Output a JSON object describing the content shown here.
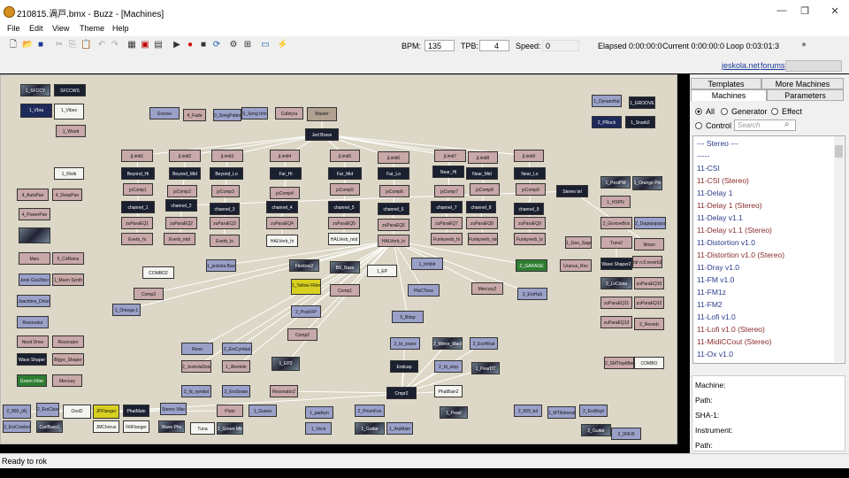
{
  "window": {
    "title": "210815.渦戸.bmx - Buzz - [Machines]",
    "minimize": "—",
    "restore": "❐",
    "close": "✕"
  },
  "menu": [
    "File",
    "Edit",
    "View",
    "Theme",
    "Help"
  ],
  "toolbar": {
    "bpm_label": "BPM:",
    "bpm_value": "135",
    "tpb_label": "TPB:",
    "tpb_value": "4",
    "speed_label": "Speed:",
    "speed_value": "0",
    "elapsed": "Elapsed 0:00:00:0",
    "current": "Current 0:00:00:0",
    "loop": "Loop 0:03:01:3"
  },
  "links": {
    "site": "jeskola.net",
    "forums": "forums"
  },
  "tabs": {
    "templates": "Templates",
    "more_machines": "More Machines",
    "machines": "Machines",
    "parameters": "Parameters"
  },
  "filters": {
    "all": "All",
    "generator": "Generator",
    "effect": "Effect",
    "control": "Control",
    "search_placeholder": "Search"
  },
  "machine_list": [
    {
      "name": "--- Stereo ---",
      "red": false
    },
    {
      "name": "-----",
      "red": false
    },
    {
      "name": "11-CSI",
      "red": false
    },
    {
      "name": "11-CSI (Stereo)",
      "red": true
    },
    {
      "name": "11-Delay 1",
      "red": false
    },
    {
      "name": "11-Delay 1 (Stereo)",
      "red": true
    },
    {
      "name": "11-Delay v1.1",
      "red": false
    },
    {
      "name": "11-Delay v1.1 (Stereo)",
      "red": true
    },
    {
      "name": "11-Distortion v1.0",
      "red": false
    },
    {
      "name": "11-Distortion v1.0 (Stereo)",
      "red": true
    },
    {
      "name": "11-Dray v1.0",
      "red": false
    },
    {
      "name": "11-FM v1.0",
      "red": false
    },
    {
      "name": "11-FM1z",
      "red": false
    },
    {
      "name": "11-FM2",
      "red": false
    },
    {
      "name": "11-Lofi v1.0",
      "red": false
    },
    {
      "name": "11-Lofi v1.0 (Stereo)",
      "red": true
    },
    {
      "name": "11-MidiCCout (Stereo)",
      "red": true
    },
    {
      "name": "11-Ox v1.0",
      "red": false
    }
  ],
  "info": {
    "machine": "Machine:",
    "path": "Path:",
    "sha": "SHA-1:",
    "instrument": "Instrument:",
    "path2": "Path:"
  },
  "status": "Ready to rok",
  "machines": [
    {
      "label": "1_SFCCY",
      "s": "img"
    },
    {
      "label": "SFCCWS",
      "s": "dark"
    },
    {
      "label": "1_Vbra",
      "s": "navy"
    },
    {
      "label": "1_Vibes",
      "s": "white"
    },
    {
      "label": "1_Wood",
      "s": "pink"
    },
    {
      "label": "1_Rivib",
      "s": "white"
    },
    {
      "label": "4_AutoPan",
      "s": "pink"
    },
    {
      "label": "4_DeepPan",
      "s": "pink"
    },
    {
      "label": "4_PowerPan",
      "s": "pink"
    },
    {
      "label": "",
      "s": "img"
    },
    {
      "label": "Marc",
      "s": "pink"
    },
    {
      "label": "5_CdReinz",
      "s": "pink"
    },
    {
      "label": "Jeek Gus2btcr",
      "s": "gen"
    },
    {
      "label": "1_Muon Synth",
      "s": "pink"
    },
    {
      "label": "Joachims_Drive",
      "s": "gen"
    },
    {
      "label": "Resonatur",
      "s": "gen"
    },
    {
      "label": "Nesit Drive",
      "s": "pink"
    },
    {
      "label": "Resonator",
      "s": "pink"
    },
    {
      "label": "Wave Shaper",
      "s": "dark"
    },
    {
      "label": "Bigyo_Shaper",
      "s": "pink"
    },
    {
      "label": "Green Filter",
      "s": "green"
    },
    {
      "label": "Mercury",
      "s": "pink"
    },
    {
      "label": "Groove",
      "s": "gen"
    },
    {
      "label": "4_Fade",
      "s": "pink"
    },
    {
      "label": "0_SongPattern",
      "s": "gen"
    },
    {
      "label": "0_Song Info",
      "s": "gen"
    },
    {
      "label": "Cafelyra",
      "s": "pink"
    },
    {
      "label": "Master",
      "s": "master"
    },
    {
      "label": "Jed Brave",
      "s": "dark"
    },
    {
      "label": "jLimit1",
      "s": "pink"
    },
    {
      "label": "jLimit2",
      "s": "pink"
    },
    {
      "label": "jLimit3",
      "s": "pink"
    },
    {
      "label": "jLimit4",
      "s": "pink"
    },
    {
      "label": "jLimit5",
      "s": "pink"
    },
    {
      "label": "jLimit6",
      "s": "pink"
    },
    {
      "label": "jLimit7",
      "s": "pink"
    },
    {
      "label": "jLimit8",
      "s": "pink"
    },
    {
      "label": "jLimit9",
      "s": "pink"
    },
    {
      "label": "Beyond_Hi",
      "s": "dark"
    },
    {
      "label": "Beyond_Mid",
      "s": "dark"
    },
    {
      "label": "Beyond_Lo",
      "s": "dark"
    },
    {
      "label": "Far_Hi",
      "s": "dark"
    },
    {
      "label": "Far_Mid",
      "s": "dark"
    },
    {
      "label": "Far_Lo",
      "s": "dark"
    },
    {
      "label": "Near_Hi",
      "s": "dark"
    },
    {
      "label": "Near_Mid",
      "s": "dark"
    },
    {
      "label": "Near_Lo",
      "s": "dark"
    },
    {
      "label": "jsComp1",
      "s": "pink"
    },
    {
      "label": "jsComp2",
      "s": "pink"
    },
    {
      "label": "jsComp3",
      "s": "pink"
    },
    {
      "label": "jsComp4",
      "s": "pink"
    },
    {
      "label": "jsComp5",
      "s": "pink"
    },
    {
      "label": "jsComp6",
      "s": "pink"
    },
    {
      "label": "jsComp7",
      "s": "pink"
    },
    {
      "label": "jsComp8",
      "s": "pink"
    },
    {
      "label": "jsComp9",
      "s": "pink"
    },
    {
      "label": "channel_1",
      "s": "dark"
    },
    {
      "label": "channel_2",
      "s": "dark"
    },
    {
      "label": "channel_3",
      "s": "dark"
    },
    {
      "label": "channel_4",
      "s": "dark"
    },
    {
      "label": "channel_5",
      "s": "dark"
    },
    {
      "label": "channel_6",
      "s": "dark"
    },
    {
      "label": "channel_7",
      "s": "dark"
    },
    {
      "label": "channel_8",
      "s": "dark"
    },
    {
      "label": "channel_9",
      "s": "dark"
    },
    {
      "label": "zuParaEQ1",
      "s": "pink"
    },
    {
      "label": "zuParaEQ2",
      "s": "pink"
    },
    {
      "label": "zuParaEQ3",
      "s": "pink"
    },
    {
      "label": "zuParaEQ4",
      "s": "pink"
    },
    {
      "label": "zuParaEQ5",
      "s": "pink"
    },
    {
      "label": "zuParaEQ6",
      "s": "pink"
    },
    {
      "label": "zuParaEQ7",
      "s": "pink"
    },
    {
      "label": "zuParaEQ8",
      "s": "pink"
    },
    {
      "label": "zuParaEQ9",
      "s": "pink"
    },
    {
      "label": "Everb_hi",
      "s": "pink"
    },
    {
      "label": "Everb_mid",
      "s": "pink"
    },
    {
      "label": "Everb_lo",
      "s": "pink"
    },
    {
      "label": "HALVerb_hi",
      "s": "white"
    },
    {
      "label": "HALVerb_mid",
      "s": "white"
    },
    {
      "label": "HALVerb_lo",
      "s": "pink"
    },
    {
      "label": "Funkyverb_hi",
      "s": "pink"
    },
    {
      "label": "Funkyverb_mid",
      "s": "pink"
    },
    {
      "label": "Funkyverb_lo",
      "s": "pink"
    },
    {
      "label": "Stereo tel",
      "s": "dark"
    },
    {
      "label": "1_DynamHat",
      "s": "gen"
    },
    {
      "label": "1_GROOVE",
      "s": "dark"
    },
    {
      "label": "2_PRock",
      "s": "navy"
    },
    {
      "label": "1_Snarb2",
      "s": "dark"
    },
    {
      "label": "1_PestPM",
      "s": "img"
    },
    {
      "label": "1_Orange Pin",
      "s": "img"
    },
    {
      "label": "1_HXPN",
      "s": "pink"
    },
    {
      "label": "2_GrooveBox",
      "s": "pink"
    },
    {
      "label": "2_Dagopapaya",
      "s": "gen"
    },
    {
      "label": "1_Geo_Sage",
      "s": "pink"
    },
    {
      "label": "Tuns2",
      "s": "pink"
    },
    {
      "label": "Iktium",
      "s": "pink"
    },
    {
      "label": "Uranus_Rev",
      "s": "pink"
    },
    {
      "label": "Z_GARAGE",
      "s": "green"
    },
    {
      "label": "Wave Shaper2",
      "s": "dark"
    },
    {
      "label": "Idr n.0.reverb2",
      "s": "pink"
    },
    {
      "label": "2_LoCiosa",
      "s": "img"
    },
    {
      "label": "zuParaEQ10",
      "s": "pink"
    },
    {
      "label": "zuParaEQ11",
      "s": "pink"
    },
    {
      "label": "zuParaEQ12",
      "s": "pink"
    },
    {
      "label": "zuParaEQ13",
      "s": "pink"
    },
    {
      "label": "2_Reverb",
      "s": "pink"
    },
    {
      "label": "2_SMTtopMbe",
      "s": "pink"
    },
    {
      "label": "COMBO",
      "s": "white"
    },
    {
      "label": "COMBO2",
      "s": "white"
    },
    {
      "label": "BS_Bass",
      "s": "img"
    },
    {
      "label": "Comp1",
      "s": "pink"
    },
    {
      "label": "1_EP",
      "s": "white"
    },
    {
      "label": "1_Inhibit",
      "s": "gen"
    },
    {
      "label": "1_Yellow Filter",
      "s": "yellow"
    },
    {
      "label": "Flexbox2",
      "s": "img"
    },
    {
      "label": "PbtCTone",
      "s": "gen"
    },
    {
      "label": "Mercury2",
      "s": "pink"
    },
    {
      "label": "2_ErsHub",
      "s": "gen"
    },
    {
      "label": "2_PoshXP",
      "s": "gen"
    },
    {
      "label": "Comp3",
      "s": "pink"
    },
    {
      "label": "Comp2",
      "s": "pink"
    },
    {
      "label": "1_Omega-1",
      "s": "gen"
    },
    {
      "label": "5_Bdap",
      "s": "gen"
    },
    {
      "label": "1_jeskola Bass",
      "s": "gen"
    },
    {
      "label": "1_EP2",
      "s": "img"
    },
    {
      "label": "Reso",
      "s": "gen"
    },
    {
      "label": "2_ErsCymbal",
      "s": "gen"
    },
    {
      "label": "1_Alomide",
      "s": "pink"
    },
    {
      "label": "2_JeskolaDelay",
      "s": "pink"
    },
    {
      "label": "2_Id_symbol",
      "s": "gen"
    },
    {
      "label": "2_ErsSnare",
      "s": "gen"
    },
    {
      "label": "Resonator2",
      "s": "pink"
    },
    {
      "label": "2_Id_snare",
      "s": "gen"
    },
    {
      "label": "Endcap",
      "s": "dark"
    },
    {
      "label": "2_Id_stop",
      "s": "gen"
    },
    {
      "label": "1_PearDT",
      "s": "img"
    },
    {
      "label": "2_Mirror_Machine",
      "s": "img"
    },
    {
      "label": "2_ErsHihat",
      "s": "gen"
    },
    {
      "label": "Cmpr2",
      "s": "dark"
    },
    {
      "label": "PhatBain2",
      "s": "white"
    },
    {
      "label": "2_909_(A)",
      "s": "gen"
    },
    {
      "label": "2_ErsClaves",
      "s": "gen"
    },
    {
      "label": "OooD",
      "s": "white"
    },
    {
      "label": "JPFlanger",
      "s": "yellow"
    },
    {
      "label": "PhatMain",
      "s": "dark"
    },
    {
      "label": "Stereo Vibe",
      "s": "gen"
    },
    {
      "label": "Pluto",
      "s": "pink"
    },
    {
      "label": "1_Guano",
      "s": "gen"
    },
    {
      "label": "1_padsyn",
      "s": "gen"
    },
    {
      "label": "2_PrismFun",
      "s": "gen"
    },
    {
      "label": "1_Guitar",
      "s": "img"
    },
    {
      "label": "1_Pearl",
      "s": "img"
    },
    {
      "label": "2_909_bd",
      "s": "gen"
    },
    {
      "label": "1_MT/kimeral",
      "s": "gen"
    },
    {
      "label": "2_ErsBlcpl",
      "s": "gen"
    },
    {
      "label": "2_ErsCowbel",
      "s": "gen"
    },
    {
      "label": "CarlBass1",
      "s": "img"
    },
    {
      "label": "JMChorus",
      "s": "white"
    },
    {
      "label": "FiltFlanger",
      "s": "white"
    },
    {
      "label": "Wave Pho",
      "s": "img"
    },
    {
      "label": "Tuna",
      "s": "white"
    },
    {
      "label": "2_Green Mtrx",
      "s": "img"
    },
    {
      "label": "1_Veck",
      "s": "gen"
    },
    {
      "label": "1_ArpMain",
      "s": "gen"
    },
    {
      "label": "2_Guitar",
      "s": "img"
    },
    {
      "label": "2_909-B",
      "s": "gen"
    },
    {
      "label": "2_909",
      "s": "gen"
    },
    {
      "label": "ZephodBasse",
      "s": "gen"
    },
    {
      "label": "PedalsIvenan",
      "s": "gen"
    }
  ]
}
